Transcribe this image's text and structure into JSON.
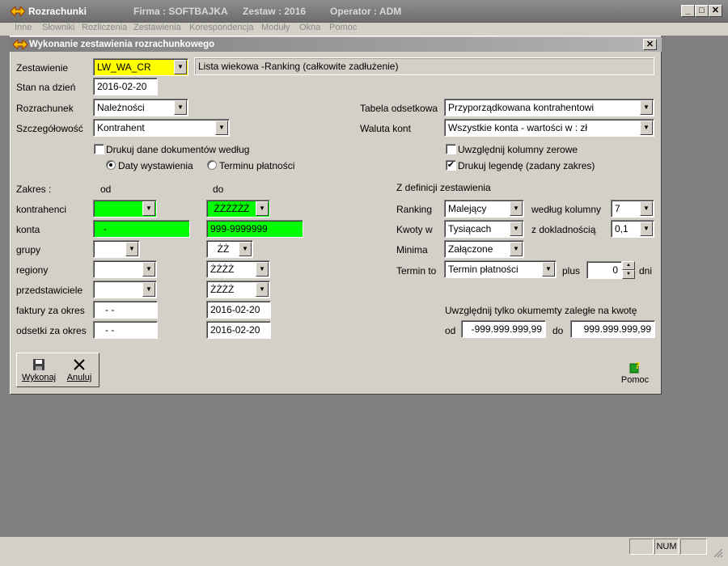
{
  "window": {
    "app_title": "Rozrachunki",
    "firma": "Firma : SOFTBAJKA",
    "zestaw": "Zestaw : 2016",
    "operator": "Operator : ADM",
    "minimize": "_",
    "restore": "□",
    "close": "✕"
  },
  "menu": [
    "Inne",
    "Słowniki",
    "Rozliczenia",
    "Zestawienia",
    "Korespondencja",
    "Moduły",
    "Okna",
    "Pomoc"
  ],
  "dialog": {
    "title": "Wykonanie zestawienia rozrachunkowego",
    "close": "✕",
    "zestawienie": {
      "label": "Zestawienie",
      "value": "LW_WA_CR",
      "description": "Lista wiekowa -Ranking (całkowite zadłużenie)"
    },
    "stan_na_dzien": {
      "label": "Stan na dzień",
      "value": "2016-02-20"
    },
    "rozrachunek": {
      "label": "Rozrachunek",
      "value": "Należności"
    },
    "szczegolowosc": {
      "label": "Szczegółowość",
      "value": "Kontrahent"
    },
    "tabela_odsetkowa": {
      "label": "Tabela odsetkowa",
      "value": "Przyporządkowana kontrahentowi"
    },
    "waluta_kont": {
      "label": "Waluta kont",
      "value": "Wszystkie konta - wartości w : zł"
    },
    "drukuj_dane": {
      "label": "Drukuj dane dokumentów według",
      "checked": false
    },
    "daty_wystawienia": {
      "label": "Daty wystawienia",
      "selected": true
    },
    "terminu_platnosci": {
      "label": "Terminu płatności",
      "selected": false
    },
    "uwzglednij_zerowe": {
      "label": "Uwzględnij kolumny zerowe",
      "checked": false
    },
    "drukuj_legende": {
      "label": "Drukuj legendę (zadany zakres)",
      "checked": true
    },
    "zakres": {
      "label": "Zakres :",
      "od": "od",
      "do": "do",
      "rows": [
        {
          "label": "kontrahenci",
          "od": "",
          "do": "ŻŻŻŻŻŻ"
        },
        {
          "label": "konta",
          "od": "-",
          "do": "999-9999999"
        },
        {
          "label": "grupy",
          "od": "",
          "do": "ŻŻ"
        },
        {
          "label": "regiony",
          "od": "",
          "do": "ŻŻŻŻ"
        },
        {
          "label": "przedstawiciele",
          "od": "",
          "do": "ŻŻŻŻ"
        },
        {
          "label": "faktury za okres",
          "od": "- -",
          "do": "2016-02-20"
        },
        {
          "label": "odsetki za okres",
          "od": "- -",
          "do": "2016-02-20"
        }
      ]
    },
    "z_definicji": {
      "label": "Z definicji zestawienia",
      "ranking": {
        "label": "Ranking",
        "value": "Malejący"
      },
      "wedlug_kolumny": {
        "label": "według kolumny",
        "value": "7"
      },
      "kwoty_w": {
        "label": "Kwoty w",
        "value": "Tysiącach"
      },
      "z_dokladnoscia": {
        "label": "z dokladnością",
        "value": "0,1"
      },
      "minima": {
        "label": "Minima",
        "value": "Załączone"
      },
      "termin_to": {
        "label": "Termin to",
        "value": "Termin płatności"
      },
      "plus": {
        "label": "plus",
        "value": "0"
      },
      "dni": "dni"
    },
    "uwzglednij_kwote": {
      "label": "Uwzględnij tylko okumemty zaległe na kwotę",
      "od_label": "od",
      "od_value": "-999.999.999,99",
      "do_label": "do",
      "do_value": "999.999.999,99"
    },
    "buttons": {
      "wykonaj": "Wykonaj",
      "anuluj": "Anuluj",
      "pomoc": "Pomoc"
    }
  },
  "statusbar": {
    "num": "NUM"
  },
  "colors": {
    "highlight_green": "#00ff00",
    "highlight_yellow": "#ffff00",
    "face": "#d4d0c8",
    "workspace": "#808080"
  }
}
